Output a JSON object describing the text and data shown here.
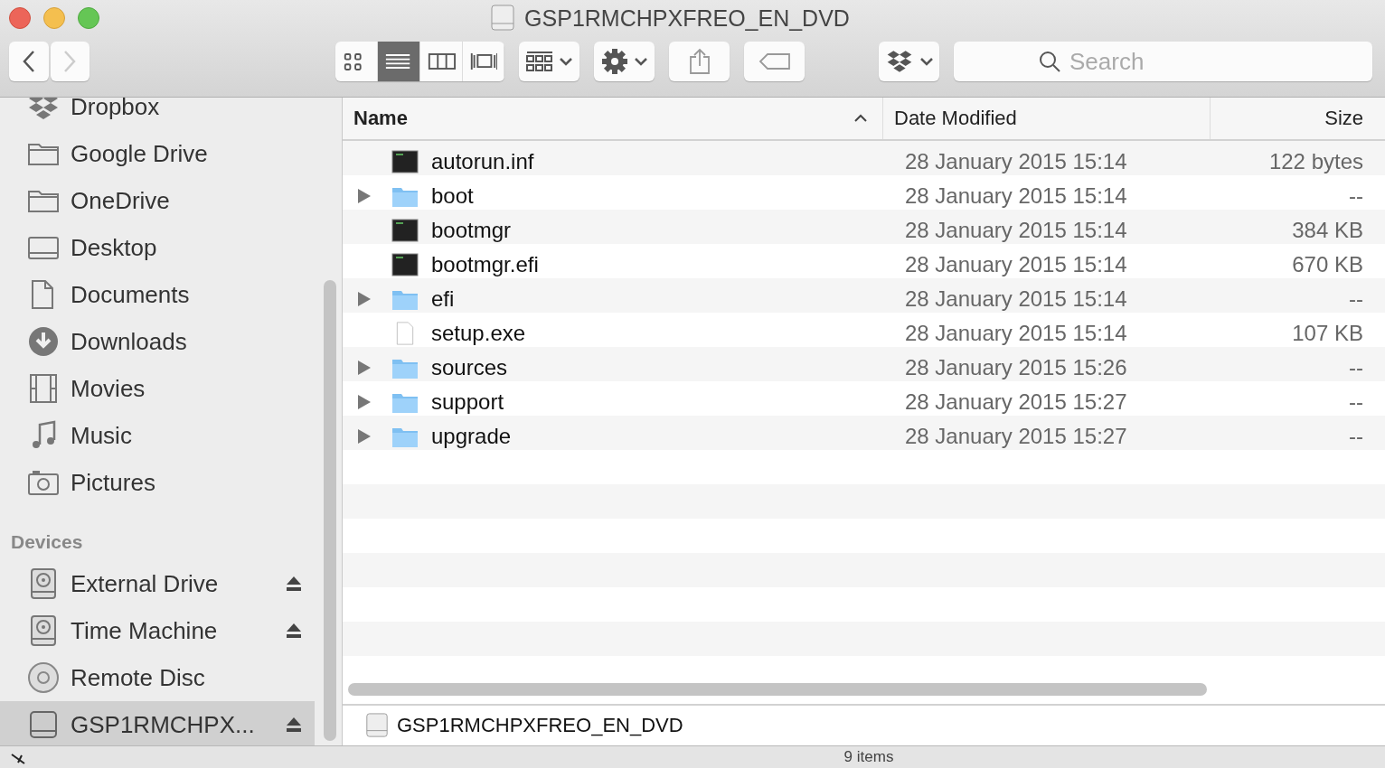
{
  "window": {
    "title": "GSP1RMCHPXFREO_EN_DVD"
  },
  "toolbar": {
    "forward_disabled": true,
    "view_modes": [
      {
        "kind": "icons",
        "selected": false
      },
      {
        "kind": "list",
        "selected": true
      },
      {
        "kind": "columns",
        "selected": false
      },
      {
        "kind": "coverflow",
        "selected": false
      }
    ],
    "search": {
      "placeholder": "Search"
    }
  },
  "sidebar": {
    "sections": [
      {
        "items": [
          {
            "label": "Dropbox",
            "kind": "dropbox",
            "eject": false,
            "selected": false
          },
          {
            "label": "Google Drive",
            "kind": "folder",
            "eject": false,
            "selected": false
          },
          {
            "label": "OneDrive",
            "kind": "folder",
            "eject": false,
            "selected": false
          },
          {
            "label": "Desktop",
            "kind": "desktop",
            "eject": false,
            "selected": false
          },
          {
            "label": "Documents",
            "kind": "documents",
            "eject": false,
            "selected": false
          },
          {
            "label": "Downloads",
            "kind": "downloads",
            "eject": false,
            "selected": false
          },
          {
            "label": "Movies",
            "kind": "movies",
            "eject": false,
            "selected": false
          },
          {
            "label": "Music",
            "kind": "music",
            "eject": false,
            "selected": false
          },
          {
            "label": "Pictures",
            "kind": "pictures",
            "eject": false,
            "selected": false
          }
        ]
      },
      {
        "title": "Devices",
        "items": [
          {
            "label": "External Drive",
            "kind": "harddisk",
            "eject": true,
            "selected": false
          },
          {
            "label": "Time Machine",
            "kind": "harddisk",
            "eject": true,
            "selected": false
          },
          {
            "label": "Remote Disc",
            "kind": "disc",
            "eject": false,
            "selected": false
          },
          {
            "label": "GSP1RMCHPX...",
            "kind": "drive",
            "eject": true,
            "selected": true
          }
        ]
      }
    ]
  },
  "table": {
    "columns": [
      {
        "label": "Name",
        "sorted": true
      },
      {
        "label": "Date Modified",
        "sorted": false
      },
      {
        "label": "Size",
        "sorted": false
      }
    ],
    "rows": [
      {
        "kind": "exec",
        "name": "autorun.inf",
        "date": "28 January 2015 15:14",
        "size": "122 bytes"
      },
      {
        "kind": "folder",
        "name": "boot",
        "date": "28 January 2015 15:14",
        "size": "--"
      },
      {
        "kind": "exec",
        "name": "bootmgr",
        "date": "28 January 2015 15:14",
        "size": "384 KB"
      },
      {
        "kind": "exec",
        "name": "bootmgr.efi",
        "date": "28 January 2015 15:14",
        "size": "670 KB"
      },
      {
        "kind": "folder",
        "name": "efi",
        "date": "28 January 2015 15:14",
        "size": "--"
      },
      {
        "kind": "document",
        "name": "setup.exe",
        "date": "28 January 2015 15:14",
        "size": "107 KB"
      },
      {
        "kind": "folder",
        "name": "sources",
        "date": "28 January 2015 15:26",
        "size": "--"
      },
      {
        "kind": "folder",
        "name": "support",
        "date": "28 January 2015 15:27",
        "size": "--"
      },
      {
        "kind": "folder",
        "name": "upgrade",
        "date": "28 January 2015 15:27",
        "size": "--"
      }
    ]
  },
  "path_bar": {
    "label": "GSP1RMCHPXFREO_EN_DVD"
  },
  "status_bar": {
    "text": "9 items"
  }
}
